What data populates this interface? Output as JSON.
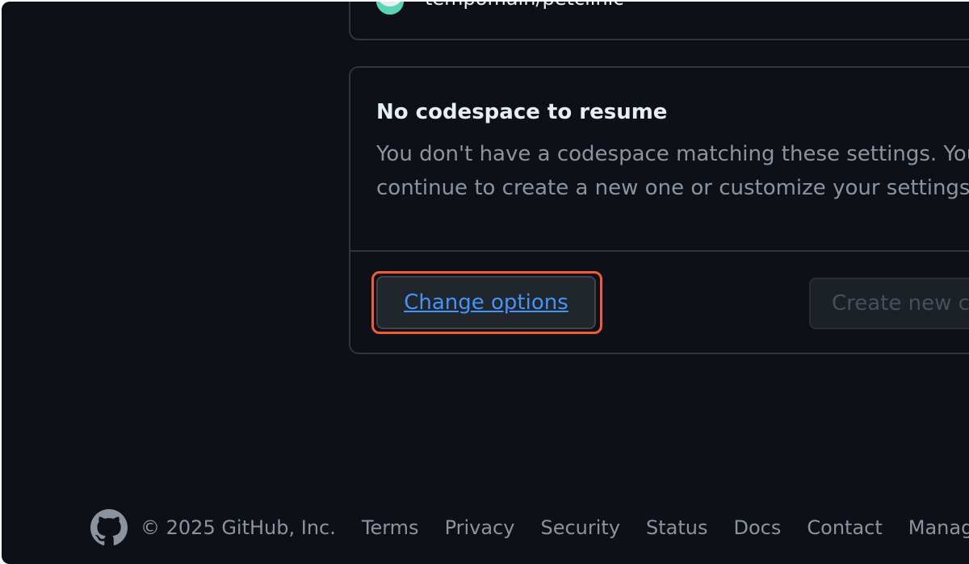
{
  "repo_card": {
    "repo_name": "tempomain/petclinic"
  },
  "resume_card": {
    "title": "No codespace to resume",
    "description_line1": "You don't have a codespace matching these settings. You",
    "description_line2": "continue to create a new one or customize your settings.",
    "change_options_label": "Change options",
    "create_new_label": "Create new co"
  },
  "footer": {
    "copyright": "© 2025 GitHub, Inc.",
    "links": [
      "Terms",
      "Privacy",
      "Security",
      "Status",
      "Docs",
      "Contact",
      "Manage cool"
    ]
  },
  "colors": {
    "background": "#0d1117",
    "highlight": "#f35b36",
    "link": "#4493f8"
  }
}
